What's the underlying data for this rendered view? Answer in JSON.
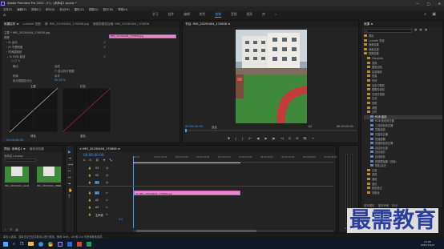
{
  "title_bar": {
    "app_title": "Adobe Premiere Pro 2020 - E:\\...\\未命名1.prproj *",
    "window_controls": [
      "—",
      "□",
      "✕"
    ]
  },
  "menu": [
    "文件(F)",
    "编辑(E)",
    "剪辑(C)",
    "序列(S)",
    "标记(M)",
    "图形(G)",
    "视图(V)",
    "窗口(W)",
    "帮助(H)"
  ],
  "workspaces": {
    "items": [
      "学习",
      "组件",
      "编辑",
      "颜色",
      "效果",
      "音频",
      "图形",
      "库"
    ],
    "active_index": 4
  },
  "effect_controls": {
    "tabs": [
      "效果控件 ≡",
      "Lumetri 范围",
      "源: IMG_20190404_170656.jpg",
      "音频剪辑混合器: IMG_20190404_170656"
    ],
    "master_label": "主要 * IMG_20190404_170656.jpg",
    "clip_label": "IMG_20190404_170656.jpg",
    "rows": [
      "运动",
      "不透明度",
      "时间重映射",
      "RGB 曲线",
      "○ □ ✎"
    ],
    "output_label": "输出",
    "output_value": "合成",
    "show_split": "☐ 显示拆分视图",
    "layout_label": "布局",
    "layout_value": "水平",
    "split_label": "拆分视图百分比",
    "split_value": "50.00 %",
    "curve_labels": [
      "主要",
      "红色"
    ],
    "curve2_labels": [
      "绿色",
      "蓝色"
    ],
    "timecode": "◦ 00:00:00:00"
  },
  "program_monitor": {
    "tab": "节目: IMG_20190404_170656 ≡",
    "timecode": "00:00:00:00",
    "fit": "适合",
    "ratio": "1/2",
    "duration": "00:00:05:00",
    "controls": [
      "▼",
      "{",
      "}",
      "|←",
      "◀|",
      "▶",
      "|▶",
      "→|",
      "⊡",
      "⊟",
      "📷",
      "+"
    ]
  },
  "project": {
    "tabs": [
      "项目: 未命名1 ≡",
      "媒体浏览器",
      "库",
      "信息"
    ],
    "path": "未命名1.prproj",
    "items": [
      {
        "name": "IMG_20190404_1...",
        "duration": "4:29"
      },
      {
        "name": "IMG_20190404_170...",
        "duration": "5:00"
      }
    ]
  },
  "timeline": {
    "tab": "× IMG_20190404_170656 ≡",
    "timecode": "00:00:00:00",
    "ruler": [
      "00:00",
      "00:00:01:00",
      "00:00:02:00",
      "00:00:03:00",
      "00:00:04:00",
      "00:00:05:00",
      "00:00:06:00",
      "00:00:07:00",
      "00:00:08:00",
      "00:00:09:00"
    ],
    "tracks": [
      "V3",
      "V2",
      "V1",
      "A1",
      "A2",
      "A3",
      "主声道"
    ],
    "master_value": "0.0",
    "clip_label": "fx IMG_20190404_170656.jpg"
  },
  "effects_panel": {
    "tab": "效果 ≡",
    "search_placeholder": "",
    "tree": [
      {
        "label": "预设",
        "indent": 0
      },
      {
        "label": "Lumetri 预设",
        "indent": 0
      },
      {
        "label": "音频效果",
        "indent": 0
      },
      {
        "label": "音频过渡",
        "indent": 0
      },
      {
        "label": "视频效果",
        "indent": 0
      },
      {
        "label": "Obsolete",
        "indent": 1
      },
      {
        "label": "变换",
        "indent": 1
      },
      {
        "label": "图像控制",
        "indent": 1
      },
      {
        "label": "实用程序",
        "indent": 1
      },
      {
        "label": "扭曲",
        "indent": 1
      },
      {
        "label": "时间",
        "indent": 1
      },
      {
        "label": "杂色与颗粒",
        "indent": 1
      },
      {
        "label": "模糊与锐化",
        "indent": 1
      },
      {
        "label": "沉浸式视频",
        "indent": 1
      },
      {
        "label": "生成",
        "indent": 1
      },
      {
        "label": "视频",
        "indent": 1
      },
      {
        "label": "调整",
        "indent": 1
      },
      {
        "label": "过时",
        "indent": 1
      },
      {
        "label": "RGB 曲线",
        "indent": 2,
        "selected": true
      },
      {
        "label": "RGB 颜色校正器",
        "indent": 2
      },
      {
        "label": "三向颜色校正器",
        "indent": 2
      },
      {
        "label": "亮度曲线",
        "indent": 2
      },
      {
        "label": "亮度校正器",
        "indent": 2
      },
      {
        "label": "快速模糊",
        "indent": 2
      },
      {
        "label": "快速颜色校正器",
        "indent": 2
      },
      {
        "label": "自动对比度",
        "indent": 2
      },
      {
        "label": "自动色阶",
        "indent": 2
      },
      {
        "label": "自动颜色",
        "indent": 2
      },
      {
        "label": "视频限幅器（旧版）",
        "indent": 2
      },
      {
        "label": "阴影/高光",
        "indent": 2
      },
      {
        "label": "过渡",
        "indent": 1
      },
      {
        "label": "透视",
        "indent": 1
      },
      {
        "label": "通道",
        "indent": 1
      },
      {
        "label": "键控",
        "indent": 1
      },
      {
        "label": "颜色校正",
        "indent": 1
      },
      {
        "label": "风格化",
        "indent": 1
      }
    ],
    "bottom_tabs": [
      "基本图形",
      "基本声音",
      "标记"
    ]
  },
  "status_bar": {
    "text": "单击以选择，或单击空白处并拖动以进行框选。使用 Shift、Alt 和 Ctrl 可获得其他选项。"
  },
  "watermark": "最需教育",
  "taskbar": {
    "time": "14:26",
    "date": "2021/11/24"
  },
  "colors": {
    "accent": "#3fa0ff",
    "clip": "#e78ad2",
    "track_on": "#2d6ea8",
    "watermark": "#2b3f9c"
  }
}
